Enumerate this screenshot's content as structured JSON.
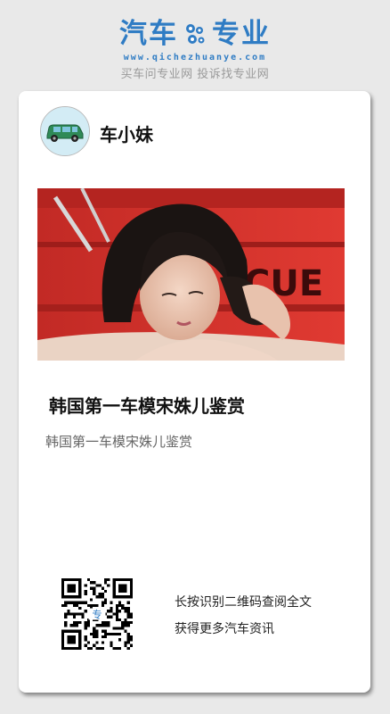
{
  "brand": {
    "name_left": "汽车",
    "name_right": "专业",
    "domain": "www.qichezhuanye.com",
    "slogan": "买车问专业网 投诉找专业网",
    "color": "#2f7cc4"
  },
  "author": {
    "name": "车小妹",
    "avatar_icon": "green-car-icon"
  },
  "article": {
    "cover_icon": "photo-image",
    "cover_text": "CUE",
    "title": "韩国第一车模宋姝儿鉴赏",
    "summary": "韩国第一车模宋姝儿鉴赏"
  },
  "footer": {
    "qr_icon": "qr-code-icon",
    "qr_center": "专",
    "line1": "长按识别二维码查阅全文",
    "line2": "获得更多汽车资讯"
  }
}
